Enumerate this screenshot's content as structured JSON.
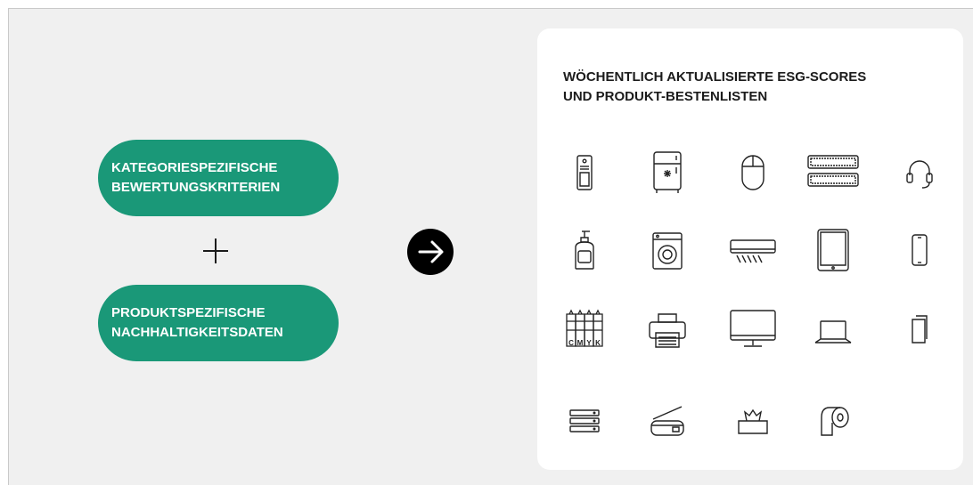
{
  "colors": {
    "accent": "#1a9878",
    "background": "#f0f0f0",
    "panel": "#ffffff",
    "text_dark": "#1b1b1b",
    "icon_stroke": "#222222"
  },
  "inputs": {
    "criteria": "KATEGORIESPEZIFISCHE\nBEWERTUNGSKRITERIEN",
    "data": "PRODUKTSPEZIFISCHE\nNACHHALTIGKEITSDATEN"
  },
  "operator_icon": "plus-icon",
  "flow_icon": "arrow-right-circle-icon",
  "output": {
    "title": "WÖCHENTLICH AKTUALISIERTE ESG-SCORES\nUND PRODUKT-BESTENLISTEN",
    "toner_letters": [
      "C",
      "M",
      "Y",
      "K"
    ],
    "icons": [
      "pc-tower-icon",
      "refrigerator-icon",
      "computer-mouse-icon",
      "keyboard-icon",
      "headset-icon",
      "soap-dispenser-icon",
      "washing-machine-icon",
      "air-conditioner-icon",
      "tablet-icon",
      "smartphone-icon",
      "toner-cartridges-icon",
      "printer-icon",
      "monitor-icon",
      "laptop-icon",
      "paper-stack-icon",
      "server-icon",
      "scanner-icon",
      "tissue-box-icon",
      "toilet-paper-icon"
    ]
  }
}
